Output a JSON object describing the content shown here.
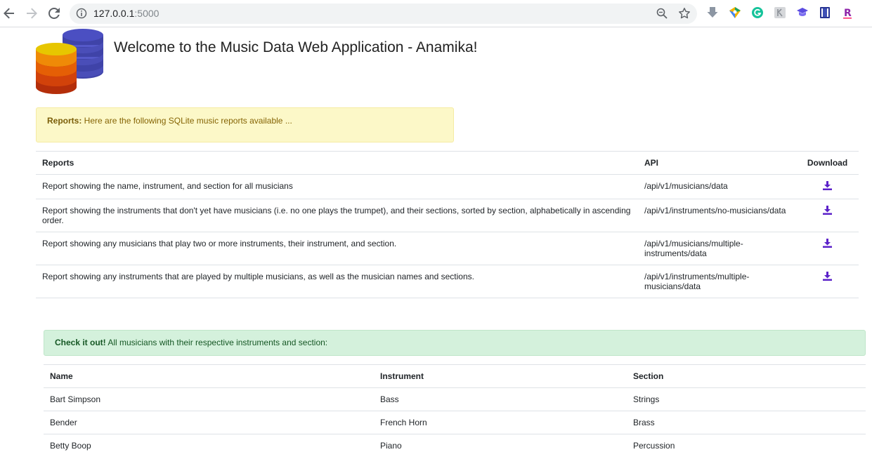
{
  "browser": {
    "url_host": "127.0.0.1",
    "url_port": ":5000"
  },
  "page": {
    "title": "Welcome to the Music Data Web Application - Anamika!",
    "reports_alert": {
      "strong": "Reports:",
      "text": " Here are the following SQLite music reports available ..."
    },
    "reports_table": {
      "headers": [
        "Reports",
        "API",
        "Download"
      ],
      "rows": [
        {
          "report": "Report showing the name, instrument, and section for all musicians",
          "api": "/api/v1/musicians/data"
        },
        {
          "report": "Report showing the instruments that don't yet have musicians (i.e. no one plays the trumpet), and their sections, sorted by section, alphabetically in ascending order.",
          "api": "/api/v1/instruments/no-musicians/data"
        },
        {
          "report": "Report showing any musicians that play two or more instruments, their instrument, and section.",
          "api": "/api/v1/musicians/multiple-instruments/data"
        },
        {
          "report": "Report showing any instruments that are played by multiple musicians, as well as the musician names and sections.",
          "api": "/api/v1/instruments/multiple-musicians/data"
        }
      ]
    },
    "musicians_alert": {
      "strong": "Check it out!",
      "text": " All musicians with their respective instruments and section:"
    },
    "musicians_table": {
      "headers": [
        "Name",
        "Instrument",
        "Section"
      ],
      "rows": [
        {
          "name": "Bart Simpson",
          "instrument": "Bass",
          "section": "Strings"
        },
        {
          "name": "Bender",
          "instrument": "French Horn",
          "section": "Brass"
        },
        {
          "name": "Betty Boop",
          "instrument": "Piano",
          "section": "Percussion"
        }
      ]
    }
  },
  "colors": {
    "download_icon": "#5b21c9",
    "alert_yellow_bg": "#fcf8c8",
    "alert_green_bg": "#d4f1dc"
  }
}
